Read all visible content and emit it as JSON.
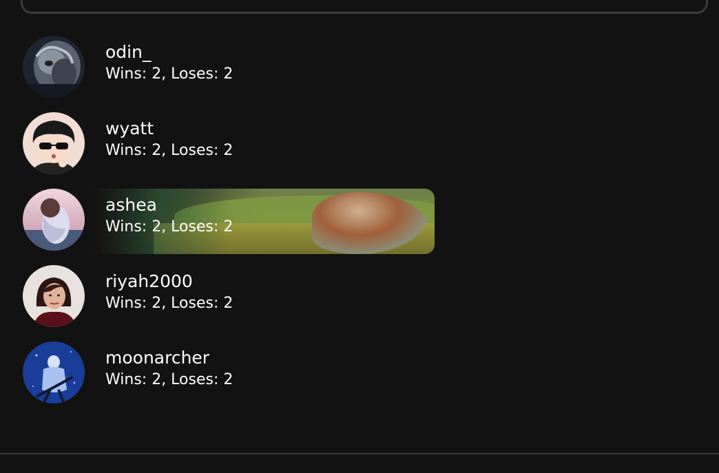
{
  "players": [
    {
      "name": "odin_",
      "stats": "Wins: 2, Loses: 2",
      "highlighted": false,
      "avatar": "odin-avatar"
    },
    {
      "name": "wyatt",
      "stats": "Wins: 2, Loses: 2",
      "highlighted": false,
      "avatar": "wyatt-avatar"
    },
    {
      "name": "ashea",
      "stats": "Wins: 2, Loses: 2",
      "highlighted": true,
      "avatar": "ashea-avatar"
    },
    {
      "name": "riyah2000",
      "stats": "Wins: 2, Loses: 2",
      "highlighted": false,
      "avatar": "riyah-avatar"
    },
    {
      "name": "moonarcher",
      "stats": "Wins: 2, Loses: 2",
      "highlighted": false,
      "avatar": "moonarcher-avatar"
    }
  ],
  "colors": {
    "background": "#121212",
    "border": "#3a3a3a",
    "text": "#ffffff"
  }
}
